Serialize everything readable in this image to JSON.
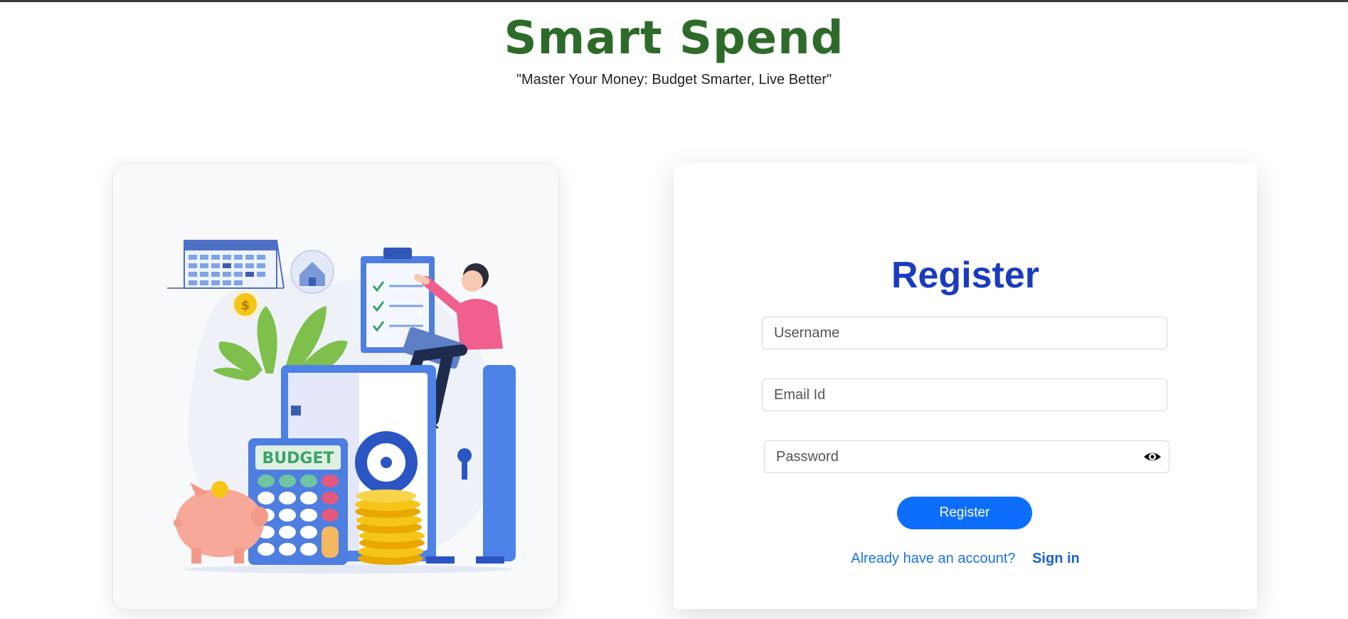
{
  "header": {
    "title": "Smart Spend",
    "tagline": "\"Master Your Money: Budget Smarter, Live Better\""
  },
  "illustration": {
    "budget_label": "BUDGET",
    "coin_symbol": "$"
  },
  "form": {
    "title": "Register",
    "username_placeholder": "Username",
    "email_placeholder": "Email Id",
    "password_placeholder": "Password",
    "register_button": "Register",
    "account_question": "Already have an account?",
    "signin_link": "Sign in"
  },
  "colors": {
    "title_green": "#2e6b2a",
    "form_title_blue": "#1b3bbf",
    "button_blue": "#0d6efd"
  }
}
